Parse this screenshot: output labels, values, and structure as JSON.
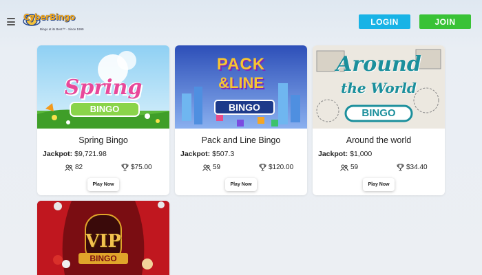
{
  "header": {
    "logo_text": "CyberBingo",
    "logo_tagline": "Bingo at its Best™ - Since 1999",
    "login_label": "LOGIN",
    "join_label": "JOIN",
    "colors": {
      "login": "#18b3e6",
      "join": "#39c236"
    }
  },
  "games": [
    {
      "title": "Spring Bingo",
      "jackpot_label": "Jackpot:",
      "jackpot_value": "$9,721.98",
      "players": "82",
      "prize": "$75.00",
      "button": "Play Now",
      "image_title": "Spring",
      "image_badge": "BINGO"
    },
    {
      "title": "Pack and Line Bingo",
      "jackpot_label": "Jackpot:",
      "jackpot_value": "$507.3",
      "players": "59",
      "prize": "$120.00",
      "button": "Play Now",
      "image_title_1": "PACK",
      "image_title_2": "&LINE",
      "image_badge": "BINGO"
    },
    {
      "title": "Around the world",
      "jackpot_label": "Jackpot:",
      "jackpot_value": "$1,000",
      "players": "59",
      "prize": "$34.40",
      "button": "Play Now",
      "image_title_1": "Around",
      "image_title_2": "the World",
      "image_badge": "BINGO"
    },
    {
      "image_title": "VIP",
      "image_badge": "BINGO"
    }
  ]
}
